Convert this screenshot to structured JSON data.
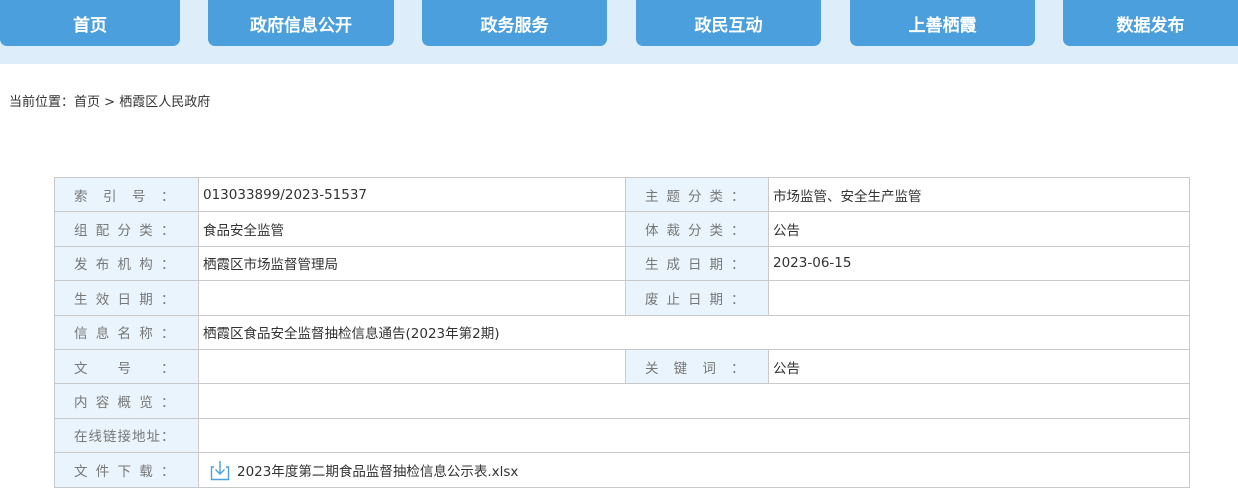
{
  "nav": {
    "items": [
      "首页",
      "政府信息公开",
      "政务服务",
      "政民互动",
      "上善栖霞",
      "数据发布"
    ]
  },
  "breadcrumb": {
    "prefix": "当前位置：",
    "home": "首页",
    "separator": ">",
    "current": "栖霞区人民政府"
  },
  "info": {
    "index_no": {
      "label": "索引号：",
      "value": "013033899/2023-51537"
    },
    "topic": {
      "label": "主题分类：",
      "value": "市场监管、安全生产监管"
    },
    "org_category": {
      "label": "组配分类：",
      "value": "食品安全监管"
    },
    "genre": {
      "label": "体裁分类：",
      "value": "公告"
    },
    "publisher": {
      "label": "发布机构：",
      "value": "栖霞区市场监督管理局"
    },
    "created": {
      "label": "生成日期：",
      "value": "2023-06-15"
    },
    "effective": {
      "label": "生效日期：",
      "value": ""
    },
    "abolished": {
      "label": "废止日期：",
      "value": ""
    },
    "title": {
      "label": "信息名称：",
      "value": "栖霞区食品安全监督抽检信息通告(2023年第2期)"
    },
    "doc_no": {
      "label": "文号：",
      "value": ""
    },
    "keywords": {
      "label": "关键词：",
      "value": "公告"
    },
    "summary": {
      "label": "内容概览：",
      "value": ""
    },
    "online_link": {
      "label": "在线链接地址：",
      "value": ""
    },
    "download": {
      "label": "文件下载：",
      "file_name": "2023年度第二期食品监督抽检信息公示表.xlsx",
      "icon": "download-icon"
    }
  },
  "colors": {
    "nav": "#4a9fdc",
    "nav_band": "#ddeefa",
    "label_bg": "#eaf4fc",
    "border": "#c9c9c9"
  }
}
